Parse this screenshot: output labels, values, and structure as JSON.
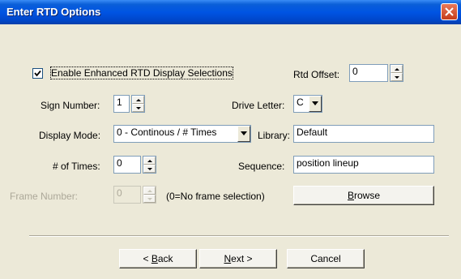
{
  "window": {
    "title": "Enter RTD Options"
  },
  "enhanced": {
    "label": "Enable Enhanced RTD Display Selections",
    "checked": true
  },
  "rtd_offset": {
    "label": "Rtd Offset:",
    "value": "0"
  },
  "sign_number": {
    "label": "Sign Number:",
    "value": "1"
  },
  "drive_letter": {
    "label": "Drive Letter:",
    "value": "C"
  },
  "display_mode": {
    "label": "Display Mode:",
    "value": "0 - Continous / # Times"
  },
  "library": {
    "label": "Library:",
    "value": "Default"
  },
  "times": {
    "label": "# of Times:",
    "value": "0"
  },
  "sequence": {
    "label": "Sequence:",
    "value": "position lineup"
  },
  "frame_number": {
    "label": "Frame Number:",
    "value": "0",
    "hint": "(0=No frame selection)"
  },
  "buttons": {
    "browse": {
      "accel": "B",
      "rest": "rowse"
    },
    "back": {
      "prefix": "< ",
      "accel": "B",
      "rest": "ack"
    },
    "next": {
      "accel": "N",
      "rest": "ext >"
    },
    "cancel": "Cancel"
  }
}
